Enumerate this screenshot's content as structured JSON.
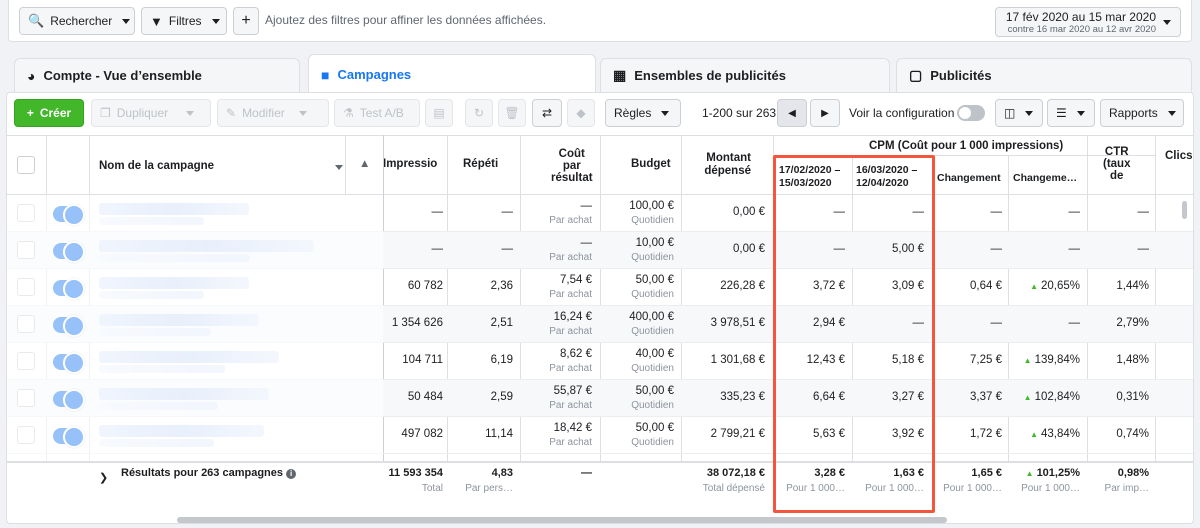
{
  "topbar": {
    "search_label": "Rechercher",
    "filters_label": "Filtres",
    "add_label": "+",
    "hint": "Ajoutez des filtres pour affiner les données affichées.",
    "date_range": "17 fév 2020 au 15 mar 2020",
    "compare_range": "contre 16 mar 2020 au 12 avr 2020"
  },
  "tabs": [
    {
      "label": "Compte - Vue d’ensemble",
      "icon": "gauge-icon"
    },
    {
      "label": "Campagnes",
      "icon": "folder-icon"
    },
    {
      "label": "Ensembles de publicités",
      "icon": "grid-icon"
    },
    {
      "label": "Publicités",
      "icon": "ad-icon"
    }
  ],
  "toolbar": {
    "create": "Créer",
    "duplicate": "Dupliquer",
    "edit": "Modifier",
    "abtest": "Test A/B",
    "rules": "Règles",
    "pagination": "1-200 sur 263",
    "prev": "◀",
    "next": "▶",
    "config": "Voir la configuration",
    "reports": "Rapports"
  },
  "columns": {
    "name": "Nom de la campagne",
    "impressions": "Impressio",
    "repetition": "Répéti",
    "cost_result": [
      "Coût",
      "par",
      "résultat"
    ],
    "budget": "Budget",
    "spent": [
      "Montant",
      "dépensé"
    ],
    "cpm_group": "CPM (Coût pour 1 000 impressions)",
    "cpm_period1": [
      "17/02/2020 –",
      "15/03/2020"
    ],
    "cpm_period2": [
      "16/03/2020 –",
      "12/04/2020"
    ],
    "change": "Changement",
    "change_pct": "Changeme…",
    "ctr": [
      "CTR",
      "(taux",
      "de"
    ],
    "clicks": "Clics"
  },
  "rows": [
    {
      "impressions": "—",
      "rep": "—",
      "cost": "—",
      "cost_sub": "Par achat",
      "budget": "100,00 €",
      "budget_sub": "Quotidien",
      "spent": "0,00 €",
      "cpm1": "—",
      "cpm2": "—",
      "chg": "—",
      "chgpct": "—",
      "ctr": "—",
      "up": false
    },
    {
      "impressions": "—",
      "rep": "—",
      "cost": "—",
      "cost_sub": "Par achat",
      "budget": "10,00 €",
      "budget_sub": "Quotidien",
      "spent": "0,00 €",
      "cpm1": "—",
      "cpm2": "5,00 €",
      "chg": "—",
      "chgpct": "—",
      "ctr": "—",
      "up": false
    },
    {
      "impressions": "60 782",
      "rep": "2,36",
      "cost": "7,54 €",
      "cost_sub": "Par achat",
      "budget": "50,00 €",
      "budget_sub": "Quotidien",
      "spent": "226,28 €",
      "cpm1": "3,72 €",
      "cpm2": "3,09 €",
      "chg": "0,64 €",
      "chgpct": "20,65%",
      "ctr": "1,44%",
      "up": true
    },
    {
      "impressions": "1 354 626",
      "rep": "2,51",
      "cost": "16,24 €",
      "cost_sub": "Par achat",
      "budget": "400,00 €",
      "budget_sub": "Quotidien",
      "spent": "3 978,51 €",
      "cpm1": "2,94 €",
      "cpm2": "—",
      "chg": "—",
      "chgpct": "—",
      "ctr": "2,79%",
      "up": false
    },
    {
      "impressions": "104 711",
      "rep": "6,19",
      "cost": "8,62 €",
      "cost_sub": "Par achat",
      "budget": "40,00 €",
      "budget_sub": "Quotidien",
      "spent": "1 301,68 €",
      "cpm1": "12,43 €",
      "cpm2": "5,18 €",
      "chg": "7,25 €",
      "chgpct": "139,84%",
      "ctr": "1,48%",
      "up": true
    },
    {
      "impressions": "50 484",
      "rep": "2,59",
      "cost": "55,87 €",
      "cost_sub": "Par achat",
      "budget": "50,00 €",
      "budget_sub": "Quotidien",
      "spent": "335,23 €",
      "cpm1": "6,64 €",
      "cpm2": "3,27 €",
      "chg": "3,37 €",
      "chgpct": "102,84%",
      "ctr": "0,31%",
      "up": true
    },
    {
      "impressions": "497 082",
      "rep": "11,14",
      "cost": "18,42 €",
      "cost_sub": "Par achat",
      "budget": "50,00 €",
      "budget_sub": "Quotidien",
      "spent": "2 799,21 €",
      "cpm1": "5,63 €",
      "cpm2": "3,92 €",
      "chg": "1,72 €",
      "chgpct": "43,84%",
      "ctr": "0,74%",
      "up": true
    }
  ],
  "footer": {
    "label": "Résultats pour 263 campagnes",
    "impressions": "11 593 354",
    "impressions_sub": "Total",
    "rep": "4,83",
    "rep_sub": "Par pers…",
    "cost": "—",
    "spent": "38 072,18 €",
    "spent_sub": "Total dépensé",
    "cpm1": "3,28 €",
    "cpm1_sub": "Pour 1 000…",
    "cpm2": "1,63 €",
    "cpm2_sub": "Pour 1 000…",
    "chg": "1,65 €",
    "chg_sub": "Pour 1 000…",
    "chgpct": "101,25%",
    "chgpct_sub": "Pour 1 000…",
    "ctr": "0,98%",
    "ctr_sub": "Par imp…"
  },
  "colors": {
    "accent": "#1877f2",
    "create_green": "#42b72a",
    "highlight_red": "#f4553c"
  }
}
